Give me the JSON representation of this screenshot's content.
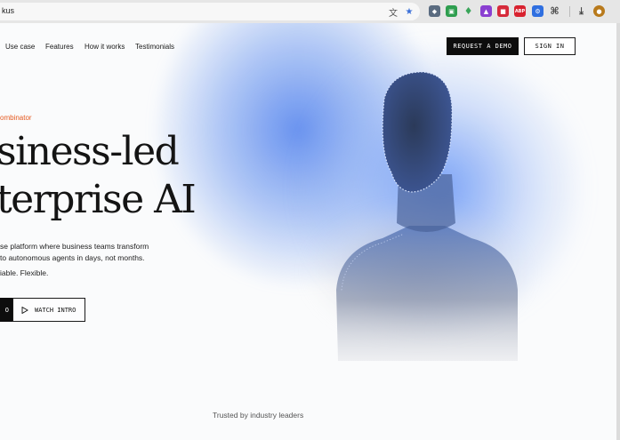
{
  "browser": {
    "url_fragment": "kus",
    "extensions": [
      "translate-icon",
      "bookmark-star-icon",
      "shield-extension-icon",
      "green-extension-icon",
      "leaf-extension-icon",
      "purple-extension-icon",
      "red-square-extension-icon",
      "adblock-extension-icon",
      "blue-gear-extension-icon",
      "puzzle-extensions-icon",
      "download-icon",
      "profile-avatar"
    ],
    "adblock_label": "ABP"
  },
  "nav": {
    "links": [
      "Use case",
      "Features",
      "How it works",
      "Testimonials"
    ],
    "request_demo": "REQUEST A DEMO",
    "sign_in": "SIGN IN"
  },
  "hero": {
    "eyebrow": "ombinator",
    "headline_line1": "siness-led",
    "headline_line2": "terprise AI",
    "body_line1": "se platform where business teams transform",
    "body_line2": "to autonomous agents in days, not months.",
    "body_line3": "iable. Flexible.",
    "cta_primary_fragment": "O",
    "cta_secondary": "WATCH INTRO"
  },
  "trusted_text": "Trusted by industry leaders",
  "colors": {
    "accent": "#e5591f",
    "glow_blue": "#5b8cef",
    "button_dark": "#0d0d0d"
  }
}
